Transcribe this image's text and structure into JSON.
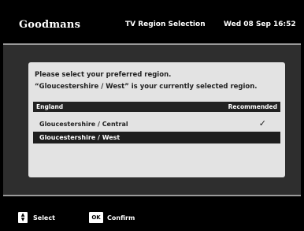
{
  "header": {
    "brand": "Goodmans",
    "title": "TV Region Selection",
    "date": "Wed 08 Sep",
    "time": "16:52"
  },
  "dialog": {
    "message_line1": "Please select your preferred region.",
    "message_line2": "“Gloucestershire / West” is your currently selected region.",
    "group": {
      "name": "England",
      "tag": "Recommended"
    },
    "regions": [
      {
        "label": "Gloucestershire / Central",
        "check": "✓"
      },
      {
        "label": "Gloucestershire / West"
      }
    ]
  },
  "footer": {
    "select_icon": "up-down-arrows",
    "select_label": "Select",
    "ok_icon_text": "OK",
    "confirm_label": "Confirm"
  },
  "colors": {
    "background": "#000000",
    "content_area": "#2e2e2e",
    "panel": "#e3e3e3",
    "highlight_row": "#1e1e1e",
    "divider": "#9a9a9a"
  }
}
